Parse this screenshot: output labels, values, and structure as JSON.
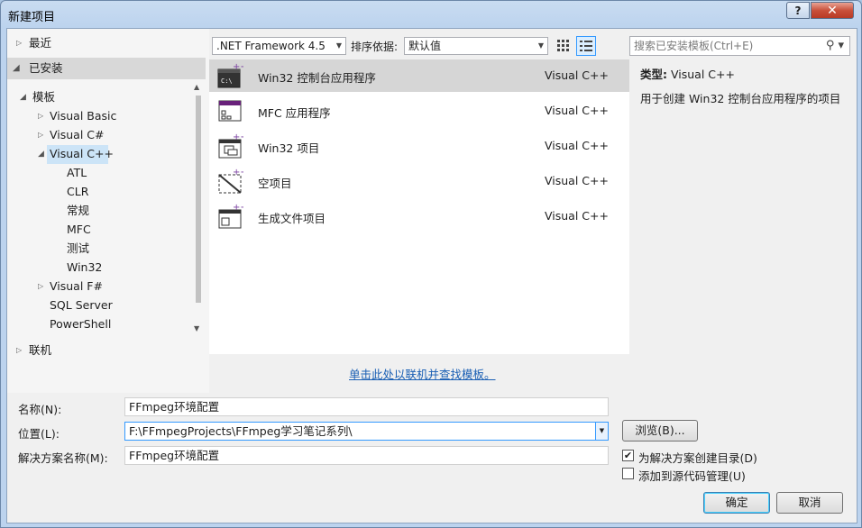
{
  "window": {
    "title": "新建项目",
    "help_label": "?",
    "close_label": "✕"
  },
  "tree": {
    "recent": "最近",
    "installed": "已安装",
    "templates": "模板",
    "vb": "Visual Basic",
    "cs": "Visual C#",
    "cpp": "Visual C++",
    "atl": "ATL",
    "clr": "CLR",
    "general": "常规",
    "mfc": "MFC",
    "test": "测试",
    "win32": "Win32",
    "fs": "Visual F#",
    "sql": "SQL Server",
    "ps": "PowerShell",
    "online": "联机"
  },
  "toolbar": {
    "framework": ".NET Framework 4.5",
    "sort_label": "排序依据:",
    "sort_value": "默认值",
    "search_placeholder": "搜索已安装模板(Ctrl+E)"
  },
  "templates": [
    {
      "name": "Win32 控制台应用程序",
      "lang": "Visual C++"
    },
    {
      "name": "MFC 应用程序",
      "lang": "Visual C++"
    },
    {
      "name": "Win32 项目",
      "lang": "Visual C++"
    },
    {
      "name": "空项目",
      "lang": "Visual C++"
    },
    {
      "name": "生成文件项目",
      "lang": "Visual C++"
    }
  ],
  "description": {
    "type_label": "类型:",
    "type_value": "Visual C++",
    "text": "用于创建 Win32 控制台应用程序的项目"
  },
  "online_link": "单击此处以联机并查找模板。",
  "form": {
    "name_label": "名称(N):",
    "name_value": "FFmpeg环境配置",
    "location_label": "位置(L):",
    "location_value": "F:\\FFmpegProjects\\FFmpeg学习笔记系列\\",
    "solution_label": "解决方案名称(M):",
    "solution_value": "FFmpeg环境配置",
    "browse": "浏览(B)...",
    "create_dir": "为解决方案创建目录(D)",
    "add_scc": "添加到源代码管理(U)",
    "ok": "确定",
    "cancel": "取消"
  }
}
